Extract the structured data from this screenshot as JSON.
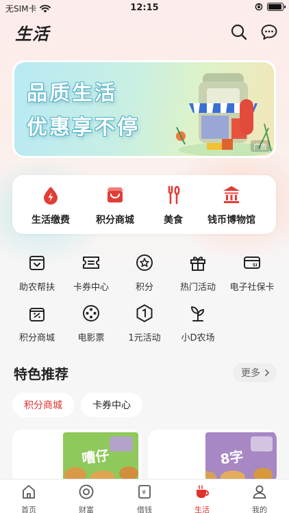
{
  "status_bar": {
    "carrier": "无SIM卡",
    "time": "12:15"
  },
  "header": {
    "title": "生活"
  },
  "banner": {
    "line1": "品质生活",
    "line2": "优惠享不停",
    "ad_label": "广告"
  },
  "main_services": [
    {
      "label": "生活缴费",
      "icon": "bill-payment-icon"
    },
    {
      "label": "积分商城",
      "icon": "points-mall-icon"
    },
    {
      "label": "美食",
      "icon": "food-icon"
    },
    {
      "label": "钱币博物馆",
      "icon": "museum-icon"
    }
  ],
  "grid_services": [
    {
      "label": "助农帮扶",
      "icon": "farm-help-icon"
    },
    {
      "label": "卡券中心",
      "icon": "coupon-icon"
    },
    {
      "label": "积分",
      "icon": "points-icon"
    },
    {
      "label": "热门活动",
      "icon": "gift-icon"
    },
    {
      "label": "电子社保卡",
      "icon": "social-card-icon"
    },
    {
      "label": "积分商城",
      "icon": "points-mall-icon"
    },
    {
      "label": "电影票",
      "icon": "film-icon"
    },
    {
      "label": "1元活动",
      "icon": "one-yuan-icon"
    },
    {
      "label": "小D农场",
      "icon": "sprout-icon"
    }
  ],
  "featured": {
    "title": "特色推荐",
    "more_label": "更多",
    "filters": [
      "积分商城",
      "卡券中心"
    ]
  },
  "tabs": [
    {
      "label": "首页",
      "icon": "home-icon"
    },
    {
      "label": "财富",
      "icon": "wealth-icon"
    },
    {
      "label": "借钱",
      "icon": "loan-icon"
    },
    {
      "label": "生活",
      "icon": "life-cup-icon"
    },
    {
      "label": "我的",
      "icon": "profile-icon"
    }
  ],
  "colors": {
    "accent": "#e0312d",
    "background": "#f6f6f7"
  }
}
